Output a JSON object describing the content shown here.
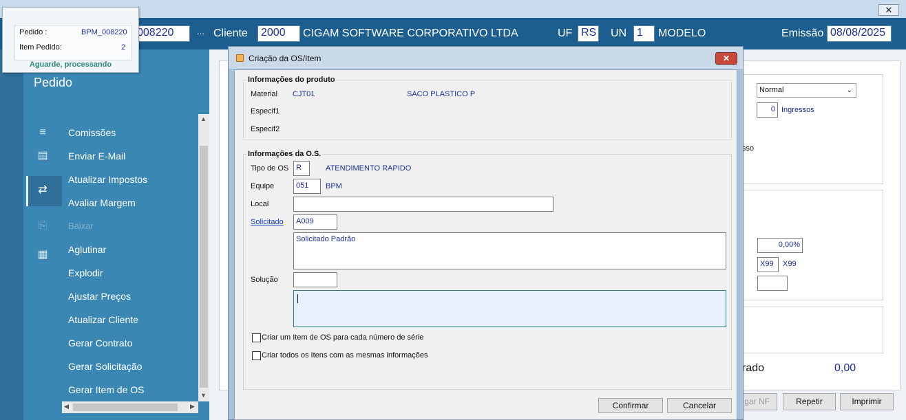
{
  "window": {
    "close_glyph": "✕"
  },
  "header": {
    "pedido_number": "008220",
    "ellipsis": "...",
    "cliente_label": "Cliente",
    "cliente_code": "2000",
    "cliente_name": "CIGAM SOFTWARE CORPORATIVO LTDA",
    "uf_label": "UF",
    "uf_value": "RS",
    "un_label": "UN",
    "un_value": "1",
    "modelo_label": "MODELO",
    "emissao_label": "Emissão",
    "emissao_value": "08/08/2025"
  },
  "popup": {
    "pedido_label": "Pedido :",
    "pedido_value": "BPM_008220",
    "item_label": "Item Pedido:",
    "item_value": "2",
    "status": "Aguarde, processando"
  },
  "sidebar": {
    "title": "Pedido",
    "items": [
      {
        "label": "Comissões",
        "icon": "≡"
      },
      {
        "label": "Enviar E-Mail",
        "icon": "▤"
      },
      {
        "label": "Atualizar Impostos",
        "icon": "⇄"
      },
      {
        "label": "Avaliar Margem",
        "icon": ""
      },
      {
        "label": "Baixar",
        "icon": "⎘"
      },
      {
        "label": "Aglutinar",
        "icon": "▦"
      },
      {
        "label": "Explodir",
        "icon": ""
      },
      {
        "label": "Ajustar Preços",
        "icon": ""
      },
      {
        "label": "Atualizar Cliente",
        "icon": ""
      },
      {
        "label": "Gerar Contrato",
        "icon": ""
      },
      {
        "label": "Gerar Solicitação",
        "icon": ""
      },
      {
        "label": "Gerar Item de OS",
        "icon": ""
      }
    ]
  },
  "right": {
    "select_value": "Normal",
    "ingressos_value": "0",
    "ingressos_label": "Ingressos",
    "partial_text": "sso",
    "percent_value": "0,00%",
    "x99_code": "X99",
    "x99_label": "X99",
    "total_label": "rado",
    "total_value": "0,00",
    "btn_nf": "gar NF",
    "btn_repetir": "Repetir",
    "btn_imprimir": "Imprimir"
  },
  "dialog": {
    "title": "Criação da OS/Item",
    "close_glyph": "✕",
    "produto": {
      "legend": "Informações do produto",
      "material_label": "Material",
      "material_code": "CJT01",
      "material_desc": "SACO PLASTICO P",
      "especif1_label": "Especif1",
      "especif2_label": "Especif2"
    },
    "os": {
      "legend": "Informações da O.S.",
      "tipo_label": "Tipo de OS",
      "tipo_value": "R",
      "tipo_desc": "ATENDIMENTO RAPIDO",
      "equipe_label": "Equipe",
      "equipe_value": "051",
      "equipe_desc": "BPM",
      "local_label": "Local",
      "local_value": "",
      "solicitado_label": "Solicitado",
      "solicitado_value": "A009",
      "solicitado_text": "Solicitado Padrão",
      "solucao_label": "Solução",
      "solucao_value": "",
      "solucao_text": ""
    },
    "checkbox1": "Criar um Item de OS para cada número de série",
    "checkbox2": "Criar todos os Itens com as mesmas informações",
    "confirm_label": "Confirmar",
    "cancel_label": "Cancelar"
  }
}
